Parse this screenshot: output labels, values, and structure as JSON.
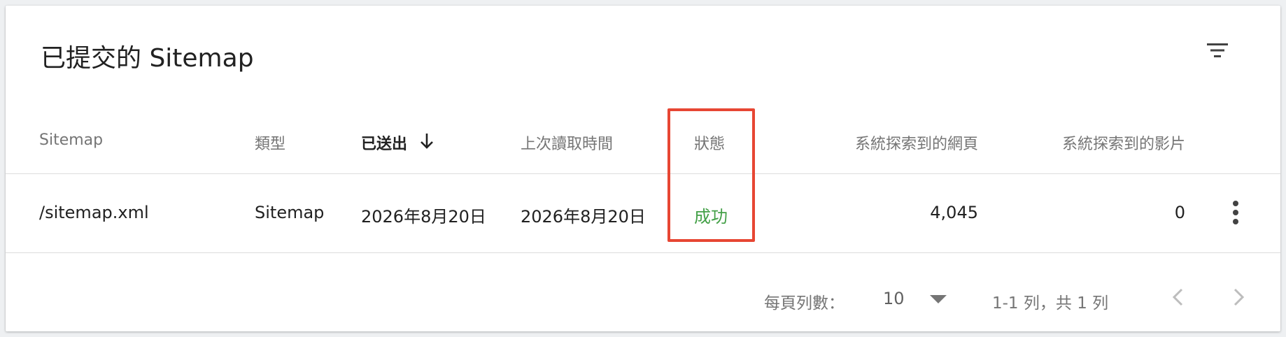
{
  "panel": {
    "title": "已提交的 Sitemap"
  },
  "table": {
    "columns": {
      "sitemap": "Sitemap",
      "type": "類型",
      "submitted": "已送出",
      "last_read": "上次讀取時間",
      "status": "狀態",
      "pages": "系統探索到的網頁",
      "videos": "系統探索到的影片"
    },
    "sort": {
      "column": "submitted",
      "direction": "descending",
      "icon": "arrow-down-icon"
    },
    "rows": [
      {
        "sitemap": "/sitemap.xml",
        "type": "Sitemap",
        "submitted": "2026年8月20日",
        "last_read": "2026年8月20日",
        "status": "成功",
        "pages": "4,045",
        "videos": "0"
      }
    ]
  },
  "pagination": {
    "rows_per_page_label": "每頁列數：",
    "rows_per_page_value": "10",
    "range_label": "1-1 列，共 1 列"
  },
  "icons": {
    "filter": "filter-icon",
    "more": "more-vert-icon",
    "dropdown": "caret-down-icon",
    "prev": "chevron-left-icon",
    "next": "chevron-right-icon"
  },
  "colors": {
    "success": "#43a047",
    "highlight_box": "#e74633",
    "header_text": "#757575",
    "body_text": "#212121"
  }
}
